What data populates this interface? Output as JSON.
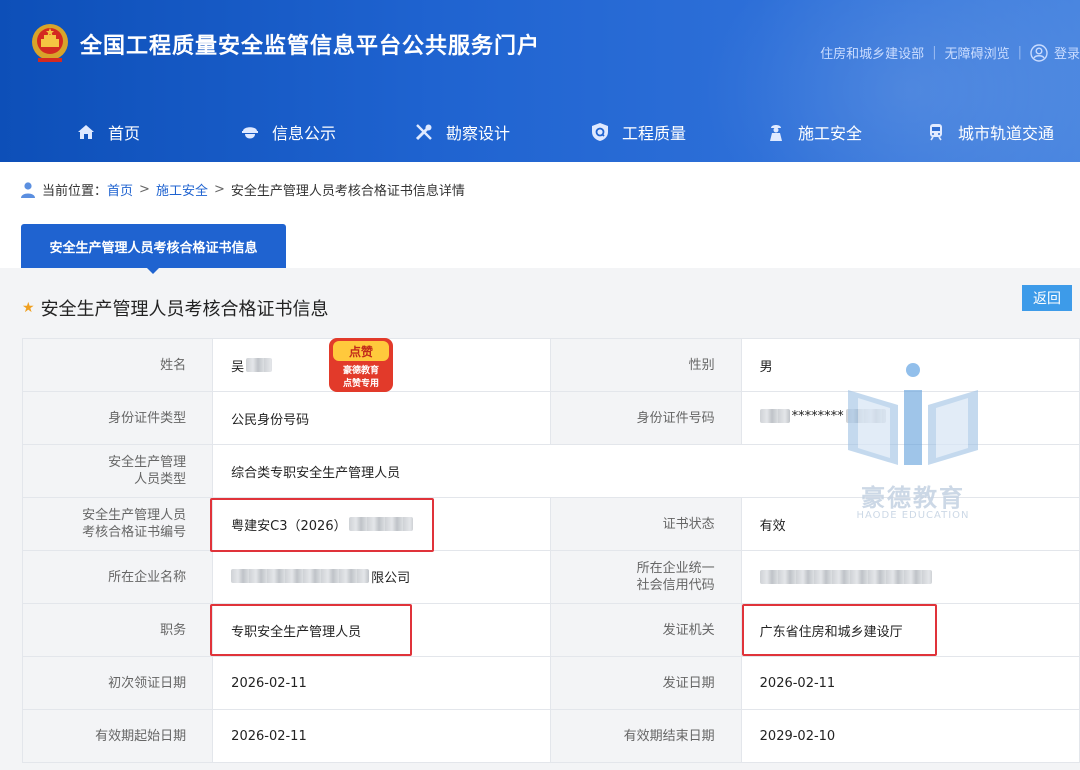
{
  "header": {
    "site_title": "全国工程质量安全监管信息平台公共服务门户",
    "links": [
      "住房和城乡建设部",
      "无障碍浏览"
    ],
    "login": "登录",
    "nav": [
      {
        "label": "首页",
        "icon": "home-icon"
      },
      {
        "label": "信息公示",
        "icon": "worker-icon"
      },
      {
        "label": "勘察设计",
        "icon": "tools-icon"
      },
      {
        "label": "工程质量",
        "icon": "shield-icon"
      },
      {
        "label": "施工安全",
        "icon": "person-icon"
      },
      {
        "label": "城市轨道交通",
        "icon": "train-icon"
      }
    ]
  },
  "breadcrumb": {
    "prefix": "当前位置：",
    "home": "首页",
    "level1": "施工安全",
    "current": "安全生产管理人员考核合格证书信息详情"
  },
  "tab": {
    "label": "安全生产管理人员考核合格证书信息"
  },
  "section": {
    "title": "安全生产管理人员考核合格证书信息",
    "back": "返回"
  },
  "table": {
    "name_label": "姓名",
    "name_value": "吴",
    "gender_label": "性别",
    "gender_value": "男",
    "id_type_label": "身份证件类型",
    "id_type_value": "公民身份号码",
    "id_no_label": "身份证件号码",
    "id_no_value": "********",
    "person_type_label_1": "安全生产管理",
    "person_type_label_2": "人员类型",
    "person_type_value": "综合类专职安全生产管理人员",
    "cert_no_label_1": "安全生产管理人员",
    "cert_no_label_2": "考核合格证书编号",
    "cert_no_value": "粤建安C3（2026）",
    "cert_status_label": "证书状态",
    "cert_status_value": "有效",
    "company_label": "所在企业名称",
    "company_value": "限公司",
    "credit_label_1": "所在企业统一",
    "credit_label_2": "社会信用代码",
    "position_label": "职务",
    "position_value": "专职安全生产管理人员",
    "issuer_label": "发证机关",
    "issuer_value": "广东省住房和城乡建设厅",
    "first_date_label": "初次领证日期",
    "first_date_value": "2026-02-11",
    "issue_date_label": "发证日期",
    "issue_date_value": "2026-02-11",
    "valid_from_label": "有效期起始日期",
    "valid_from_value": "2026-02-11",
    "valid_to_label": "有效期结束日期",
    "valid_to_value": "2029-02-10"
  },
  "sticker": {
    "line1": "点赞",
    "line2": "豪德教育",
    "line3": "点赞专用"
  },
  "watermark": {
    "cn": "豪德教育",
    "en": "HAODE EDUCATION"
  },
  "colors": {
    "header_blue": "#1f63d0",
    "highlight_red": "#e0333a",
    "back_button": "#3d9be9"
  }
}
